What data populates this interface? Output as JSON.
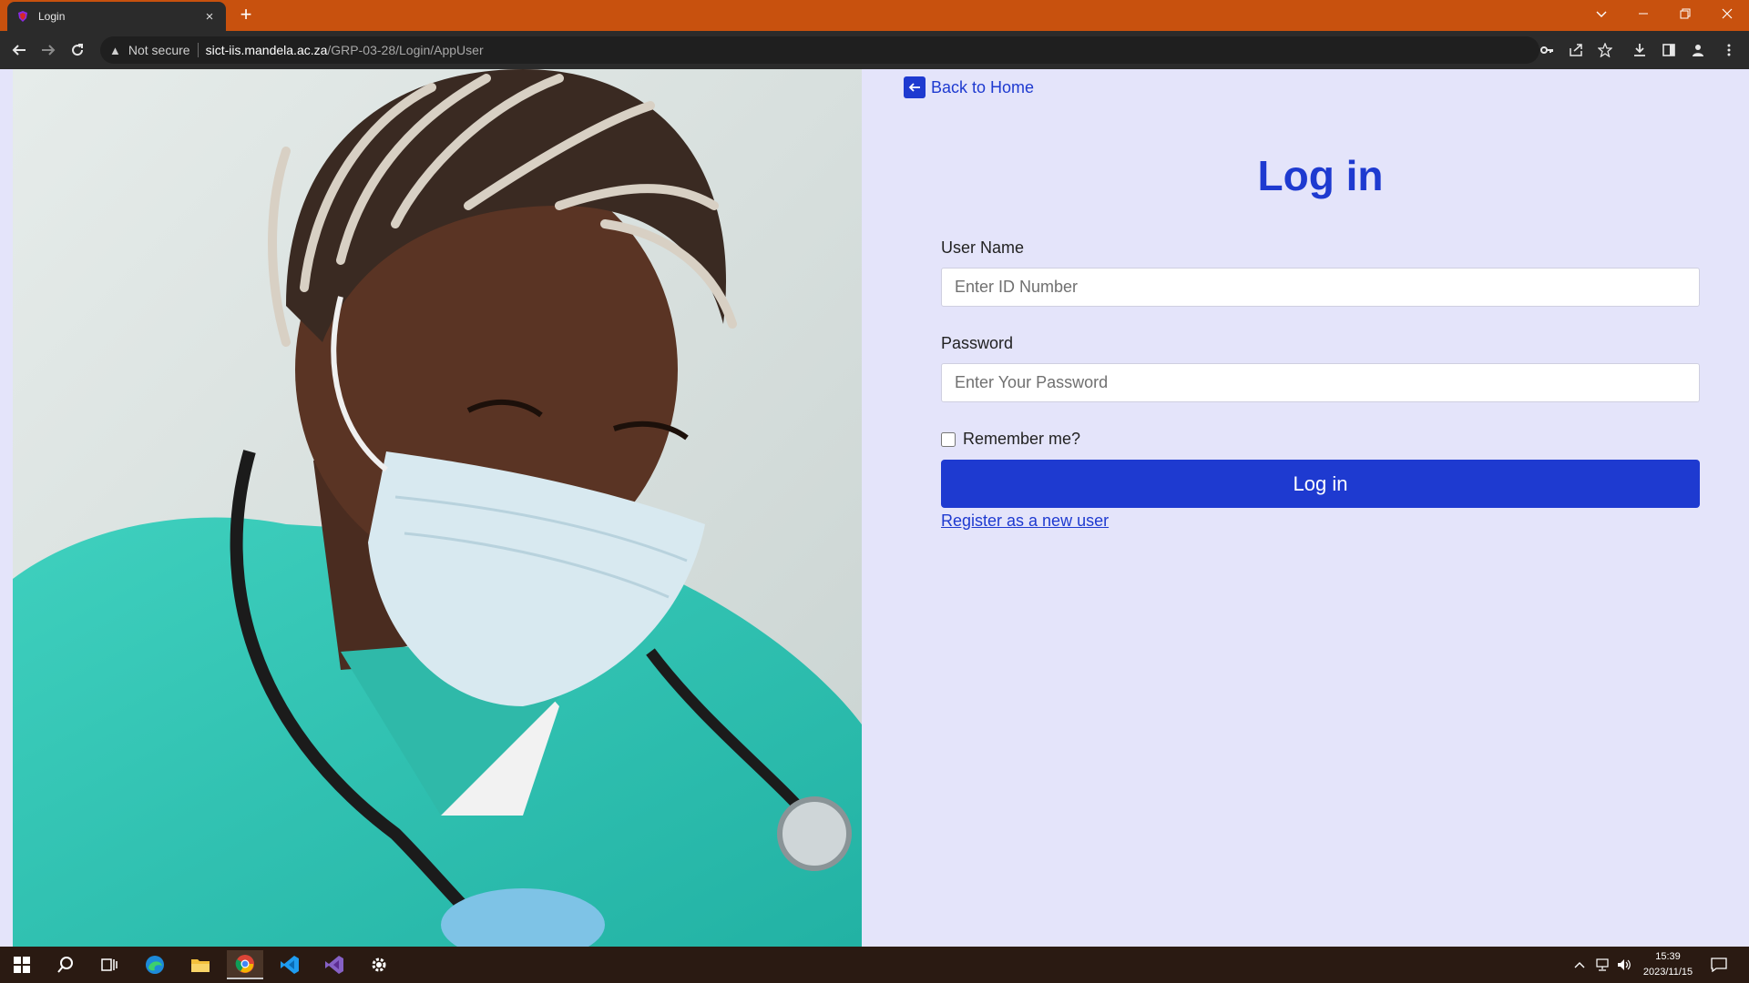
{
  "browser": {
    "tab_title": "Login",
    "tab_close": "×",
    "new_tab": "+",
    "security_label": "Not secure",
    "url_host": "sict-iis.mandela.ac.za",
    "url_path": "/GRP-03-28/Login/AppUser",
    "accent_color": "#c8510e"
  },
  "page": {
    "back_link": "Back to Home",
    "title": "Log in",
    "username_label": "User Name",
    "username_placeholder": "Enter ID Number",
    "username_value": "",
    "password_label": "Password",
    "password_placeholder": "Enter Your Password",
    "password_value": "",
    "remember_label": "Remember me?",
    "remember_checked": false,
    "submit_label": "Log in",
    "register_link": "Register as a new user",
    "primary_color": "#1e3ad0",
    "background_color": "#e4e4fa"
  },
  "taskbar": {
    "apps": [
      "windows-start-icon",
      "search-icon",
      "task-view-icon",
      "edge-icon",
      "file-explorer-icon",
      "chrome-icon",
      "vscode-icon",
      "visual-studio-icon",
      "settings-icon"
    ],
    "active_app": "chrome-icon",
    "time": "15:39",
    "date": "2023/11/15"
  }
}
